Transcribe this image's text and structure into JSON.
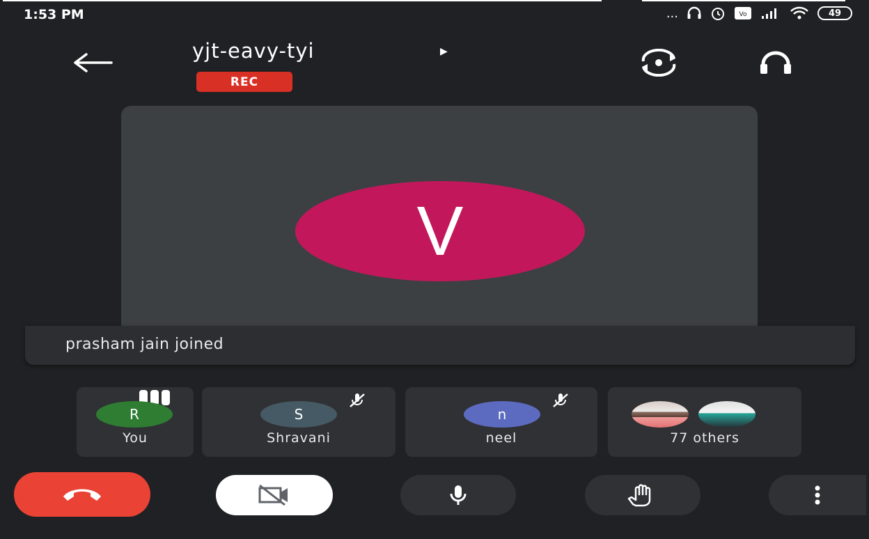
{
  "status_bar": {
    "time": "1:53 PM",
    "battery": "49",
    "dots": "..."
  },
  "header": {
    "meeting_code": "yjt-eavy-tyi",
    "rec_label": "REC"
  },
  "main_tile": {
    "avatar_letter": "V",
    "avatar_color": "#c2185b"
  },
  "notification": {
    "text": "prasham jain joined"
  },
  "participants": [
    {
      "name": "You",
      "initial": "R",
      "color": "#2e7d32",
      "muted": false
    },
    {
      "name": "Shravani",
      "initial": "S",
      "color": "#455a64",
      "muted": true
    },
    {
      "name": "neel",
      "initial": "n",
      "color": "#5c6bc0",
      "muted": true
    },
    {
      "name": "77 others"
    }
  ],
  "controls": {
    "end_call_color": "#ea4335"
  }
}
